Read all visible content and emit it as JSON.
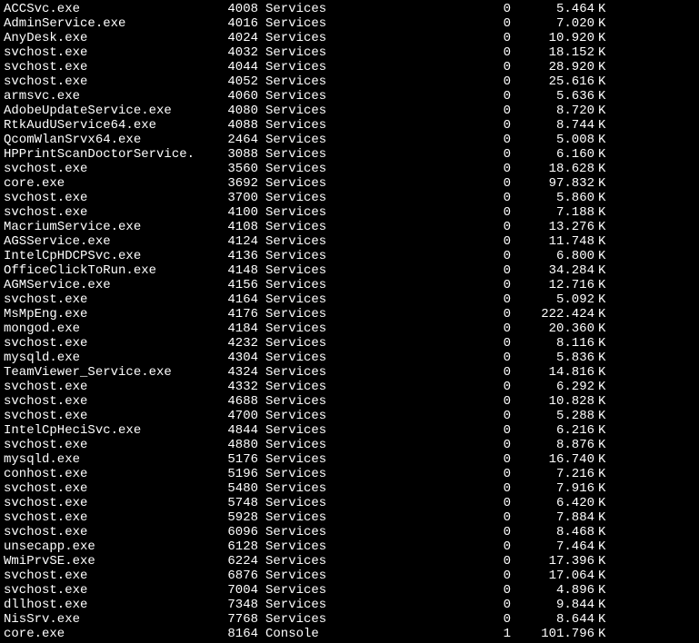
{
  "unit": "K",
  "processes": [
    {
      "name": "ACCSvc.exe",
      "pid": "4008",
      "session": "Services",
      "snum": "0",
      "mem": "5.464"
    },
    {
      "name": "AdminService.exe",
      "pid": "4016",
      "session": "Services",
      "snum": "0",
      "mem": "7.020"
    },
    {
      "name": "AnyDesk.exe",
      "pid": "4024",
      "session": "Services",
      "snum": "0",
      "mem": "10.920"
    },
    {
      "name": "svchost.exe",
      "pid": "4032",
      "session": "Services",
      "snum": "0",
      "mem": "18.152"
    },
    {
      "name": "svchost.exe",
      "pid": "4044",
      "session": "Services",
      "snum": "0",
      "mem": "28.920"
    },
    {
      "name": "svchost.exe",
      "pid": "4052",
      "session": "Services",
      "snum": "0",
      "mem": "25.616"
    },
    {
      "name": "armsvc.exe",
      "pid": "4060",
      "session": "Services",
      "snum": "0",
      "mem": "5.636"
    },
    {
      "name": "AdobeUpdateService.exe",
      "pid": "4080",
      "session": "Services",
      "snum": "0",
      "mem": "8.720"
    },
    {
      "name": "RtkAudUService64.exe",
      "pid": "4088",
      "session": "Services",
      "snum": "0",
      "mem": "8.744"
    },
    {
      "name": "QcomWlanSrvx64.exe",
      "pid": "2464",
      "session": "Services",
      "snum": "0",
      "mem": "5.008"
    },
    {
      "name": "HPPrintScanDoctorService.",
      "pid": "3088",
      "session": "Services",
      "snum": "0",
      "mem": "6.160"
    },
    {
      "name": "svchost.exe",
      "pid": "3560",
      "session": "Services",
      "snum": "0",
      "mem": "18.628"
    },
    {
      "name": "core.exe",
      "pid": "3692",
      "session": "Services",
      "snum": "0",
      "mem": "97.832"
    },
    {
      "name": "svchost.exe",
      "pid": "3700",
      "session": "Services",
      "snum": "0",
      "mem": "5.860"
    },
    {
      "name": "svchost.exe",
      "pid": "4100",
      "session": "Services",
      "snum": "0",
      "mem": "7.188"
    },
    {
      "name": "MacriumService.exe",
      "pid": "4108",
      "session": "Services",
      "snum": "0",
      "mem": "13.276"
    },
    {
      "name": "AGSService.exe",
      "pid": "4124",
      "session": "Services",
      "snum": "0",
      "mem": "11.748"
    },
    {
      "name": "IntelCpHDCPSvc.exe",
      "pid": "4136",
      "session": "Services",
      "snum": "0",
      "mem": "6.800"
    },
    {
      "name": "OfficeClickToRun.exe",
      "pid": "4148",
      "session": "Services",
      "snum": "0",
      "mem": "34.284"
    },
    {
      "name": "AGMService.exe",
      "pid": "4156",
      "session": "Services",
      "snum": "0",
      "mem": "12.716"
    },
    {
      "name": "svchost.exe",
      "pid": "4164",
      "session": "Services",
      "snum": "0",
      "mem": "5.092"
    },
    {
      "name": "MsMpEng.exe",
      "pid": "4176",
      "session": "Services",
      "snum": "0",
      "mem": "222.424"
    },
    {
      "name": "mongod.exe",
      "pid": "4184",
      "session": "Services",
      "snum": "0",
      "mem": "20.360"
    },
    {
      "name": "svchost.exe",
      "pid": "4232",
      "session": "Services",
      "snum": "0",
      "mem": "8.116"
    },
    {
      "name": "mysqld.exe",
      "pid": "4304",
      "session": "Services",
      "snum": "0",
      "mem": "5.836"
    },
    {
      "name": "TeamViewer_Service.exe",
      "pid": "4324",
      "session": "Services",
      "snum": "0",
      "mem": "14.816"
    },
    {
      "name": "svchost.exe",
      "pid": "4332",
      "session": "Services",
      "snum": "0",
      "mem": "6.292"
    },
    {
      "name": "svchost.exe",
      "pid": "4688",
      "session": "Services",
      "snum": "0",
      "mem": "10.828"
    },
    {
      "name": "svchost.exe",
      "pid": "4700",
      "session": "Services",
      "snum": "0",
      "mem": "5.288"
    },
    {
      "name": "IntelCpHeciSvc.exe",
      "pid": "4844",
      "session": "Services",
      "snum": "0",
      "mem": "6.216"
    },
    {
      "name": "svchost.exe",
      "pid": "4880",
      "session": "Services",
      "snum": "0",
      "mem": "8.876"
    },
    {
      "name": "mysqld.exe",
      "pid": "5176",
      "session": "Services",
      "snum": "0",
      "mem": "16.740"
    },
    {
      "name": "conhost.exe",
      "pid": "5196",
      "session": "Services",
      "snum": "0",
      "mem": "7.216"
    },
    {
      "name": "svchost.exe",
      "pid": "5480",
      "session": "Services",
      "snum": "0",
      "mem": "7.916"
    },
    {
      "name": "svchost.exe",
      "pid": "5748",
      "session": "Services",
      "snum": "0",
      "mem": "6.420"
    },
    {
      "name": "svchost.exe",
      "pid": "5928",
      "session": "Services",
      "snum": "0",
      "mem": "7.884"
    },
    {
      "name": "svchost.exe",
      "pid": "6096",
      "session": "Services",
      "snum": "0",
      "mem": "8.468"
    },
    {
      "name": "unsecapp.exe",
      "pid": "6128",
      "session": "Services",
      "snum": "0",
      "mem": "7.464"
    },
    {
      "name": "WmiPrvSE.exe",
      "pid": "6224",
      "session": "Services",
      "snum": "0",
      "mem": "17.396"
    },
    {
      "name": "svchost.exe",
      "pid": "6876",
      "session": "Services",
      "snum": "0",
      "mem": "17.064"
    },
    {
      "name": "svchost.exe",
      "pid": "7004",
      "session": "Services",
      "snum": "0",
      "mem": "4.896"
    },
    {
      "name": "dllhost.exe",
      "pid": "7348",
      "session": "Services",
      "snum": "0",
      "mem": "9.844"
    },
    {
      "name": "NisSrv.exe",
      "pid": "7768",
      "session": "Services",
      "snum": "0",
      "mem": "8.644"
    },
    {
      "name": "core.exe",
      "pid": "8164",
      "session": "Console",
      "snum": "1",
      "mem": "101.796"
    }
  ]
}
